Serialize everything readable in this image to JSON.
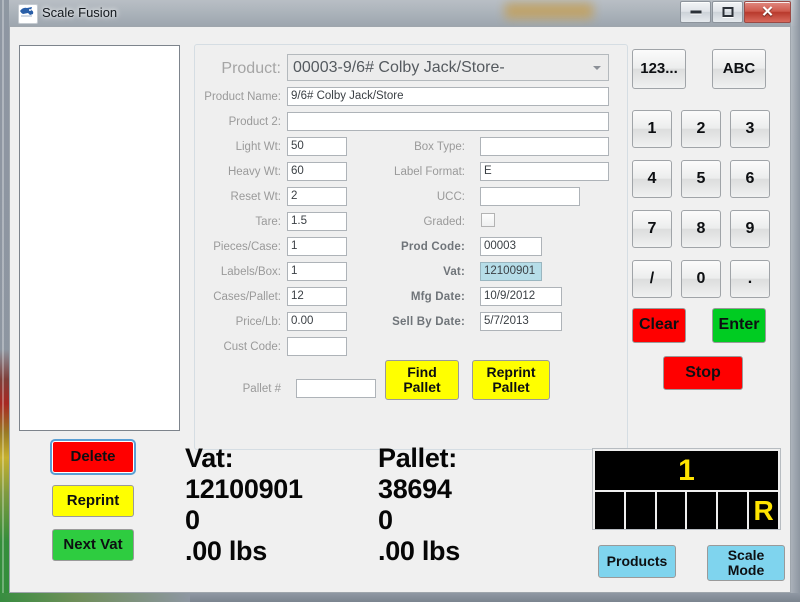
{
  "window": {
    "title": "Scale Fusion",
    "icon": "app-icon",
    "minimize_label": "",
    "maximize_label": "",
    "close_label": "✕"
  },
  "form": {
    "product": {
      "label": "Product:",
      "value": "00003-9/6# Colby Jack/Store-",
      "dropdown_icon": "chevron-down-icon"
    },
    "left_fields": [
      {
        "label": "Product Name:",
        "value": "9/6# Colby Jack/Store"
      },
      {
        "label": "Product 2:",
        "value": ""
      },
      {
        "label": "Light Wt:",
        "value": "50"
      },
      {
        "label": "Heavy Wt:",
        "value": "60"
      },
      {
        "label": "Reset Wt:",
        "value": "2"
      },
      {
        "label": "Tare:",
        "value": "1.5"
      },
      {
        "label": "Pieces/Case:",
        "value": "1"
      },
      {
        "label": "Labels/Box:",
        "value": "1"
      },
      {
        "label": "Cases/Pallet:",
        "value": "12"
      },
      {
        "label": "Price/Lb:",
        "value": "0.00"
      },
      {
        "label": "Cust Code:",
        "value": ""
      },
      {
        "label": "Pallet #",
        "value": ""
      }
    ],
    "right_fields": [
      {
        "label": "Box Type:",
        "value": "",
        "bold": false
      },
      {
        "label": "Label Format:",
        "value": "E",
        "bold": false
      },
      {
        "label": "UCC:",
        "value": "",
        "bold": false
      },
      {
        "label": "Prod Code:",
        "value": "00003",
        "bold": true
      },
      {
        "label": "Vat:",
        "value": "12100901",
        "bold": true,
        "selected": true
      },
      {
        "label": "Mfg Date:",
        "value": "10/9/2012",
        "bold": true
      },
      {
        "label": "Sell By Date:",
        "value": "5/7/2013",
        "bold": true
      }
    ],
    "graded": {
      "label": "Graded:",
      "checked": false
    },
    "find_pallet_label": "Find\nPallet",
    "reprint_pallet_label": "Reprint\nPallet"
  },
  "keypad": {
    "mode_numeric": "123...",
    "mode_alpha": "ABC",
    "keys": [
      "1",
      "2",
      "3",
      "4",
      "5",
      "6",
      "7",
      "8",
      "9",
      "/",
      "0",
      "."
    ],
    "clear_label": "Clear",
    "enter_label": "Enter",
    "stop_label": "Stop"
  },
  "side_actions": [
    {
      "label": "Delete",
      "color": "#ff0000",
      "focused": true
    },
    {
      "label": "Reprint",
      "color": "#ffff00",
      "focused": false
    },
    {
      "label": "Next Vat",
      "color": "#2ecc40",
      "focused": false
    }
  ],
  "summary": {
    "vat": {
      "title": "Vat:",
      "number": "12100901",
      "count": "0",
      "weight": ".00 lbs"
    },
    "pallet": {
      "title": "Pallet:",
      "number": "38694",
      "count": "0",
      "weight": ".00 lbs"
    }
  },
  "display": {
    "top_value": "1",
    "cells": [
      "",
      "",
      "",
      "",
      "",
      "R"
    ]
  },
  "bottom_buttons": {
    "products_label": "Products",
    "scale_mode_label": "Scale\nMode"
  },
  "colors": {
    "red": "#ff0000",
    "green": "#00cc22",
    "yellow": "#ffff00",
    "cyan": "#7fd4ee",
    "led_text": "#ffe400",
    "led_bg": "#000000",
    "selected_field": "#b6dde8"
  }
}
